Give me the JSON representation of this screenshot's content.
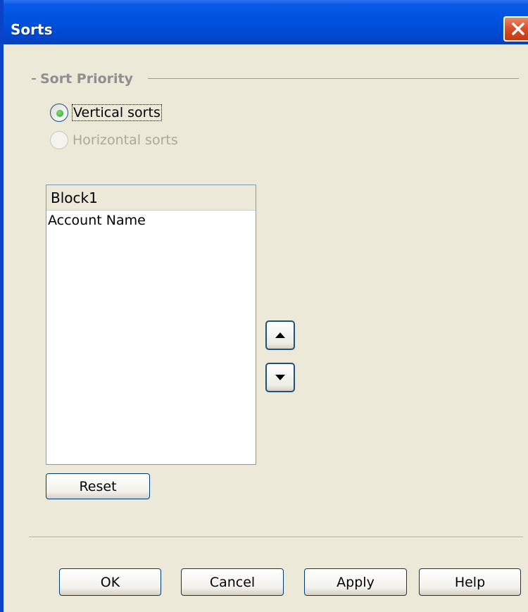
{
  "window": {
    "title": "Sorts"
  },
  "sort_priority": {
    "legend": "Sort Priority",
    "options": [
      {
        "label": "Vertical sorts",
        "checked": true,
        "enabled": true
      },
      {
        "label": "Horizontal sorts",
        "checked": false,
        "enabled": false
      }
    ]
  },
  "list": {
    "header": "Block1",
    "items": [
      "Account Name"
    ]
  },
  "buttons": {
    "reset": "Reset",
    "ok": "OK",
    "cancel": "Cancel",
    "apply": "Apply",
    "help": "Help"
  },
  "icons": {
    "close": "close-icon",
    "move_up": "arrow-up-icon",
    "move_down": "arrow-down-icon"
  },
  "colors": {
    "titlebar": "#0052DE",
    "dialog_bg": "#ECE9D8",
    "close_button": "#D84C26",
    "radio_checked": "#21A121",
    "disabled_text": "#ACA899"
  }
}
